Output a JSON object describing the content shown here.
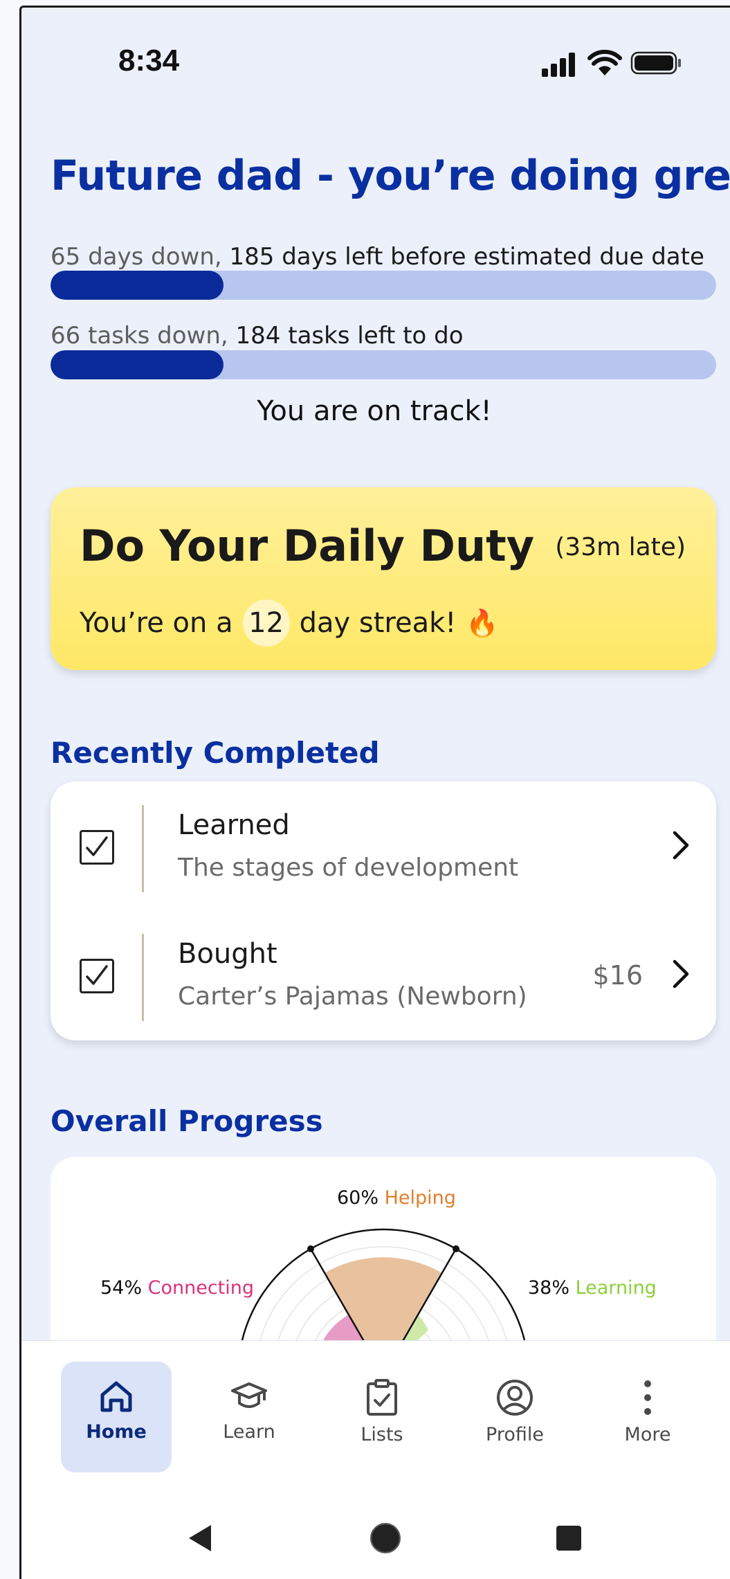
{
  "status_bar": {
    "time": "8:34",
    "icons": [
      "signal-icon",
      "wifi-icon",
      "battery-icon"
    ]
  },
  "header": {
    "title": "Future dad - you’re doing great!"
  },
  "days_progress": {
    "done_text": "65 days down,",
    "left_text": "185 days left before estimated due date",
    "fraction": 0.26
  },
  "tasks_progress": {
    "done_text": "66 tasks down,",
    "left_text": "184 tasks left to do",
    "fraction": 0.26
  },
  "status_message": "You are on track!",
  "daily_duty": {
    "title": "Do Your Daily Duty",
    "late": "(33m late)",
    "streak_prefix": "You’re on a",
    "streak_count": "12",
    "streak_suffix": "day streak!",
    "flame": "🔥"
  },
  "recently_completed": {
    "title": "Recently Completed",
    "items": [
      {
        "title": "Learned",
        "subtitle": "The stages of development",
        "price": ""
      },
      {
        "title": "Bought",
        "subtitle": "Carter’s Pajamas (Newborn)",
        "price": "$16"
      }
    ]
  },
  "overall_progress": {
    "title": "Overall Progress",
    "categories": [
      {
        "percent": "60%",
        "label": "Helping",
        "color": "#e07f2c",
        "value": 60
      },
      {
        "percent": "54%",
        "label": "Connecting",
        "color": "#d8337a",
        "value": 54
      },
      {
        "percent": "38%",
        "label": "Learning",
        "color": "#8ccf3a",
        "value": 38
      }
    ]
  },
  "bottom_nav": {
    "items": [
      {
        "label": "Home",
        "icon": "home-icon",
        "active": true
      },
      {
        "label": "Learn",
        "icon": "graduation-cap-icon",
        "active": false
      },
      {
        "label": "Lists",
        "icon": "clipboard-check-icon",
        "active": false
      },
      {
        "label": "Profile",
        "icon": "user-circle-icon",
        "active": false
      },
      {
        "label": "More",
        "icon": "more-vertical-icon",
        "active": false
      }
    ]
  },
  "colors": {
    "primary": "#0a2fa0",
    "bar_fill": "#0b2a99",
    "bar_track": "#b7c6ee",
    "duty_card": "#ffe866"
  }
}
